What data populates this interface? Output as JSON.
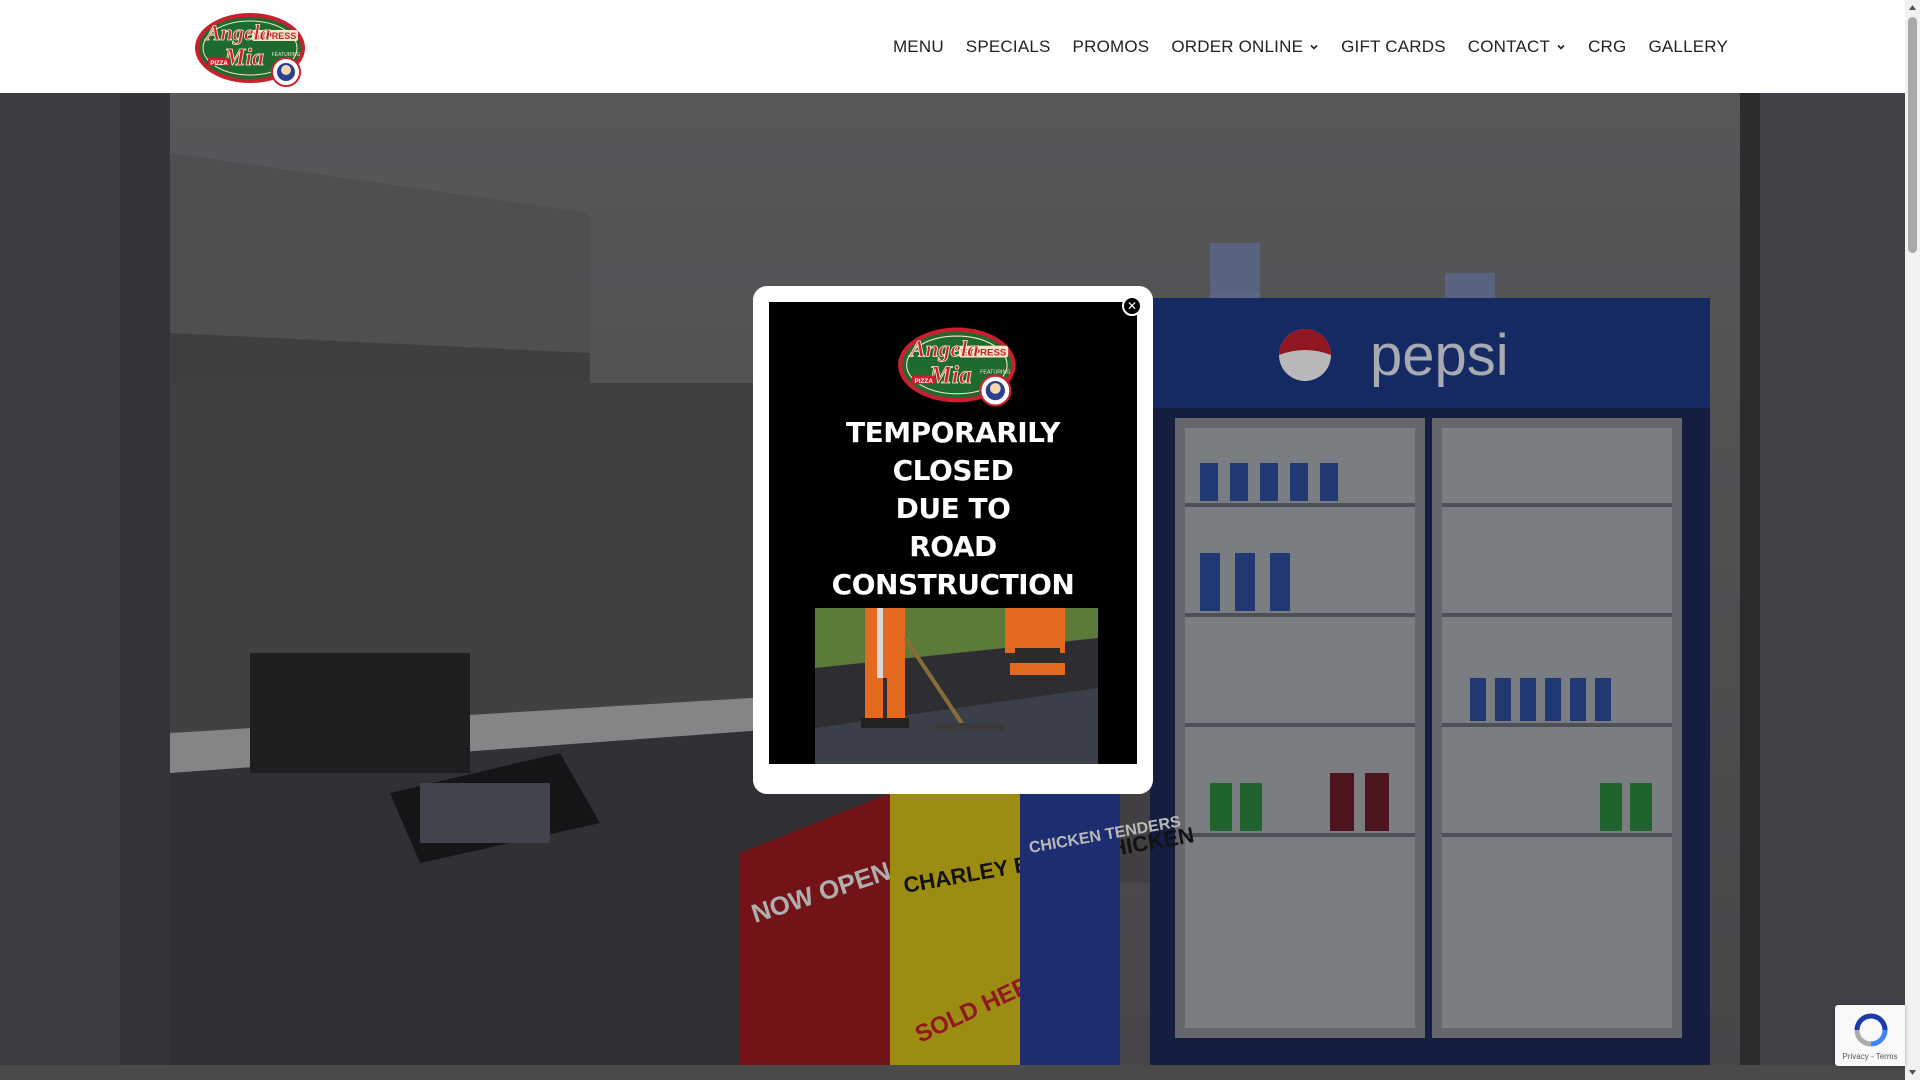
{
  "brand": {
    "logo_line1": "Angela",
    "logo_line2": "Mia",
    "logo_badge": "EXPRESS",
    "logo_sub": "PIZZA",
    "logo_feature": "FEATURING",
    "colors": {
      "green": "#1f6b2f",
      "red": "#c8202e",
      "cream": "#f5e7c6"
    }
  },
  "nav": {
    "items": [
      {
        "label": "MENU",
        "has_dropdown": false
      },
      {
        "label": "SPECIALS",
        "has_dropdown": false
      },
      {
        "label": "PROMOS",
        "has_dropdown": false
      },
      {
        "label": "ORDER ONLINE",
        "has_dropdown": true
      },
      {
        "label": "GIFT CARDS",
        "has_dropdown": false
      },
      {
        "label": "CONTACT",
        "has_dropdown": true
      },
      {
        "label": "CRG",
        "has_dropdown": false
      },
      {
        "label": "GALLERY",
        "has_dropdown": false
      }
    ]
  },
  "hero": {
    "cooler_brand": "pepsi",
    "banner_now_open": "NOW OPEN",
    "banner_charley": "CHARLEY BIGGS' CHICKEN",
    "banner_sold_here": "SOLD HERE",
    "banner_tenders": "CHICKEN TENDERS"
  },
  "popup": {
    "close_icon": "close-icon",
    "lines": [
      "TEMPORARILY",
      "CLOSED",
      "DUE TO",
      "ROAD",
      "CONSTRUCTION"
    ]
  },
  "recaptcha": {
    "text": "Privacy - Terms"
  }
}
